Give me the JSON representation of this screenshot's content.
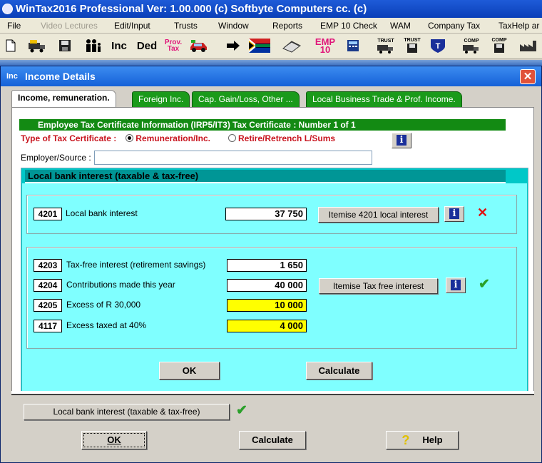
{
  "app": {
    "title": "WinTax2016 Professional Ver: 1.00.000  (c) Softbyte Computers cc. (c)"
  },
  "menu": [
    {
      "label": "File",
      "enabled": true
    },
    {
      "label": "Video Lectures",
      "enabled": false
    },
    {
      "label": "Edit/Input",
      "enabled": true
    },
    {
      "label": "Trusts",
      "enabled": true
    },
    {
      "label": "Window",
      "enabled": true
    },
    {
      "label": "Reports",
      "enabled": true
    },
    {
      "label": "EMP 10 Check",
      "enabled": true
    },
    {
      "label": "WAM",
      "enabled": true
    },
    {
      "label": "Company Tax",
      "enabled": true
    },
    {
      "label": "TaxHelp ar",
      "enabled": true
    }
  ],
  "toolbar": {
    "inc": "Inc",
    "ded": "Ded",
    "prov_tax": "Prov.\nTax",
    "emp10": "EMP\n10",
    "trust": "TRUST",
    "comp": "COMP"
  },
  "dialog": {
    "icon_text": "Inc",
    "title": "Income Details",
    "tabs": [
      {
        "label": "Income, remuneration.",
        "active": true
      },
      {
        "label": "Foreign Inc.",
        "active": false
      },
      {
        "label": "Cap. Gain/Loss, Other ...",
        "active": false
      },
      {
        "label": "Local Business Trade & Prof. Income.",
        "active": false
      }
    ],
    "cert_header": "Employee Tax Certificate Information (IRP5/IT3)     Tax Certificate : Number 1 of 1",
    "type_label": "Type of Tax Certificate :",
    "radio_remuneration": "Remuneration/Inc.",
    "radio_retire": "Retire/Retrench L/Sums",
    "employer_label": "Employer/Source :",
    "employer_value": "",
    "section_title": "Local bank interest (taxable & tax-free)",
    "local": {
      "code": "4201",
      "label": "Local bank interest",
      "value": "37 750",
      "itemise_button": "Itemise 4201 local interest"
    },
    "taxfree": {
      "rows": [
        {
          "code": "4203",
          "label": "Tax-free interest (retirement savings)",
          "value": "1 650",
          "highlight": false
        },
        {
          "code": "4204",
          "label": "Contributions made this year",
          "value": "40 000",
          "highlight": false
        },
        {
          "code": "4205",
          "label": "Excess of R 30,000",
          "value": "10 000",
          "highlight": true
        },
        {
          "code": "4117",
          "label": "Excess taxed at 40%",
          "value": "4 000",
          "highlight": true
        }
      ],
      "itemise_button": "Itemise Tax free interest"
    },
    "inner_ok": "OK",
    "inner_calculate": "Calculate",
    "summary_button": "Local bank interest (taxable & tax-free)",
    "ok": "OK",
    "calculate": "Calculate",
    "help": "Help"
  },
  "colors": {
    "title_bar": "#0a3fb8",
    "tab_green": "#1a9a1a",
    "teal_header": "#009696",
    "teal_body": "#7fffff",
    "highlight_yellow": "#ffff00",
    "error_red": "#e01010",
    "check_green": "#2aa02a"
  },
  "icons": {
    "close": "close-icon",
    "info": "info-icon",
    "cross": "cross-icon",
    "check": "checkmark-icon",
    "help": "question-icon"
  }
}
